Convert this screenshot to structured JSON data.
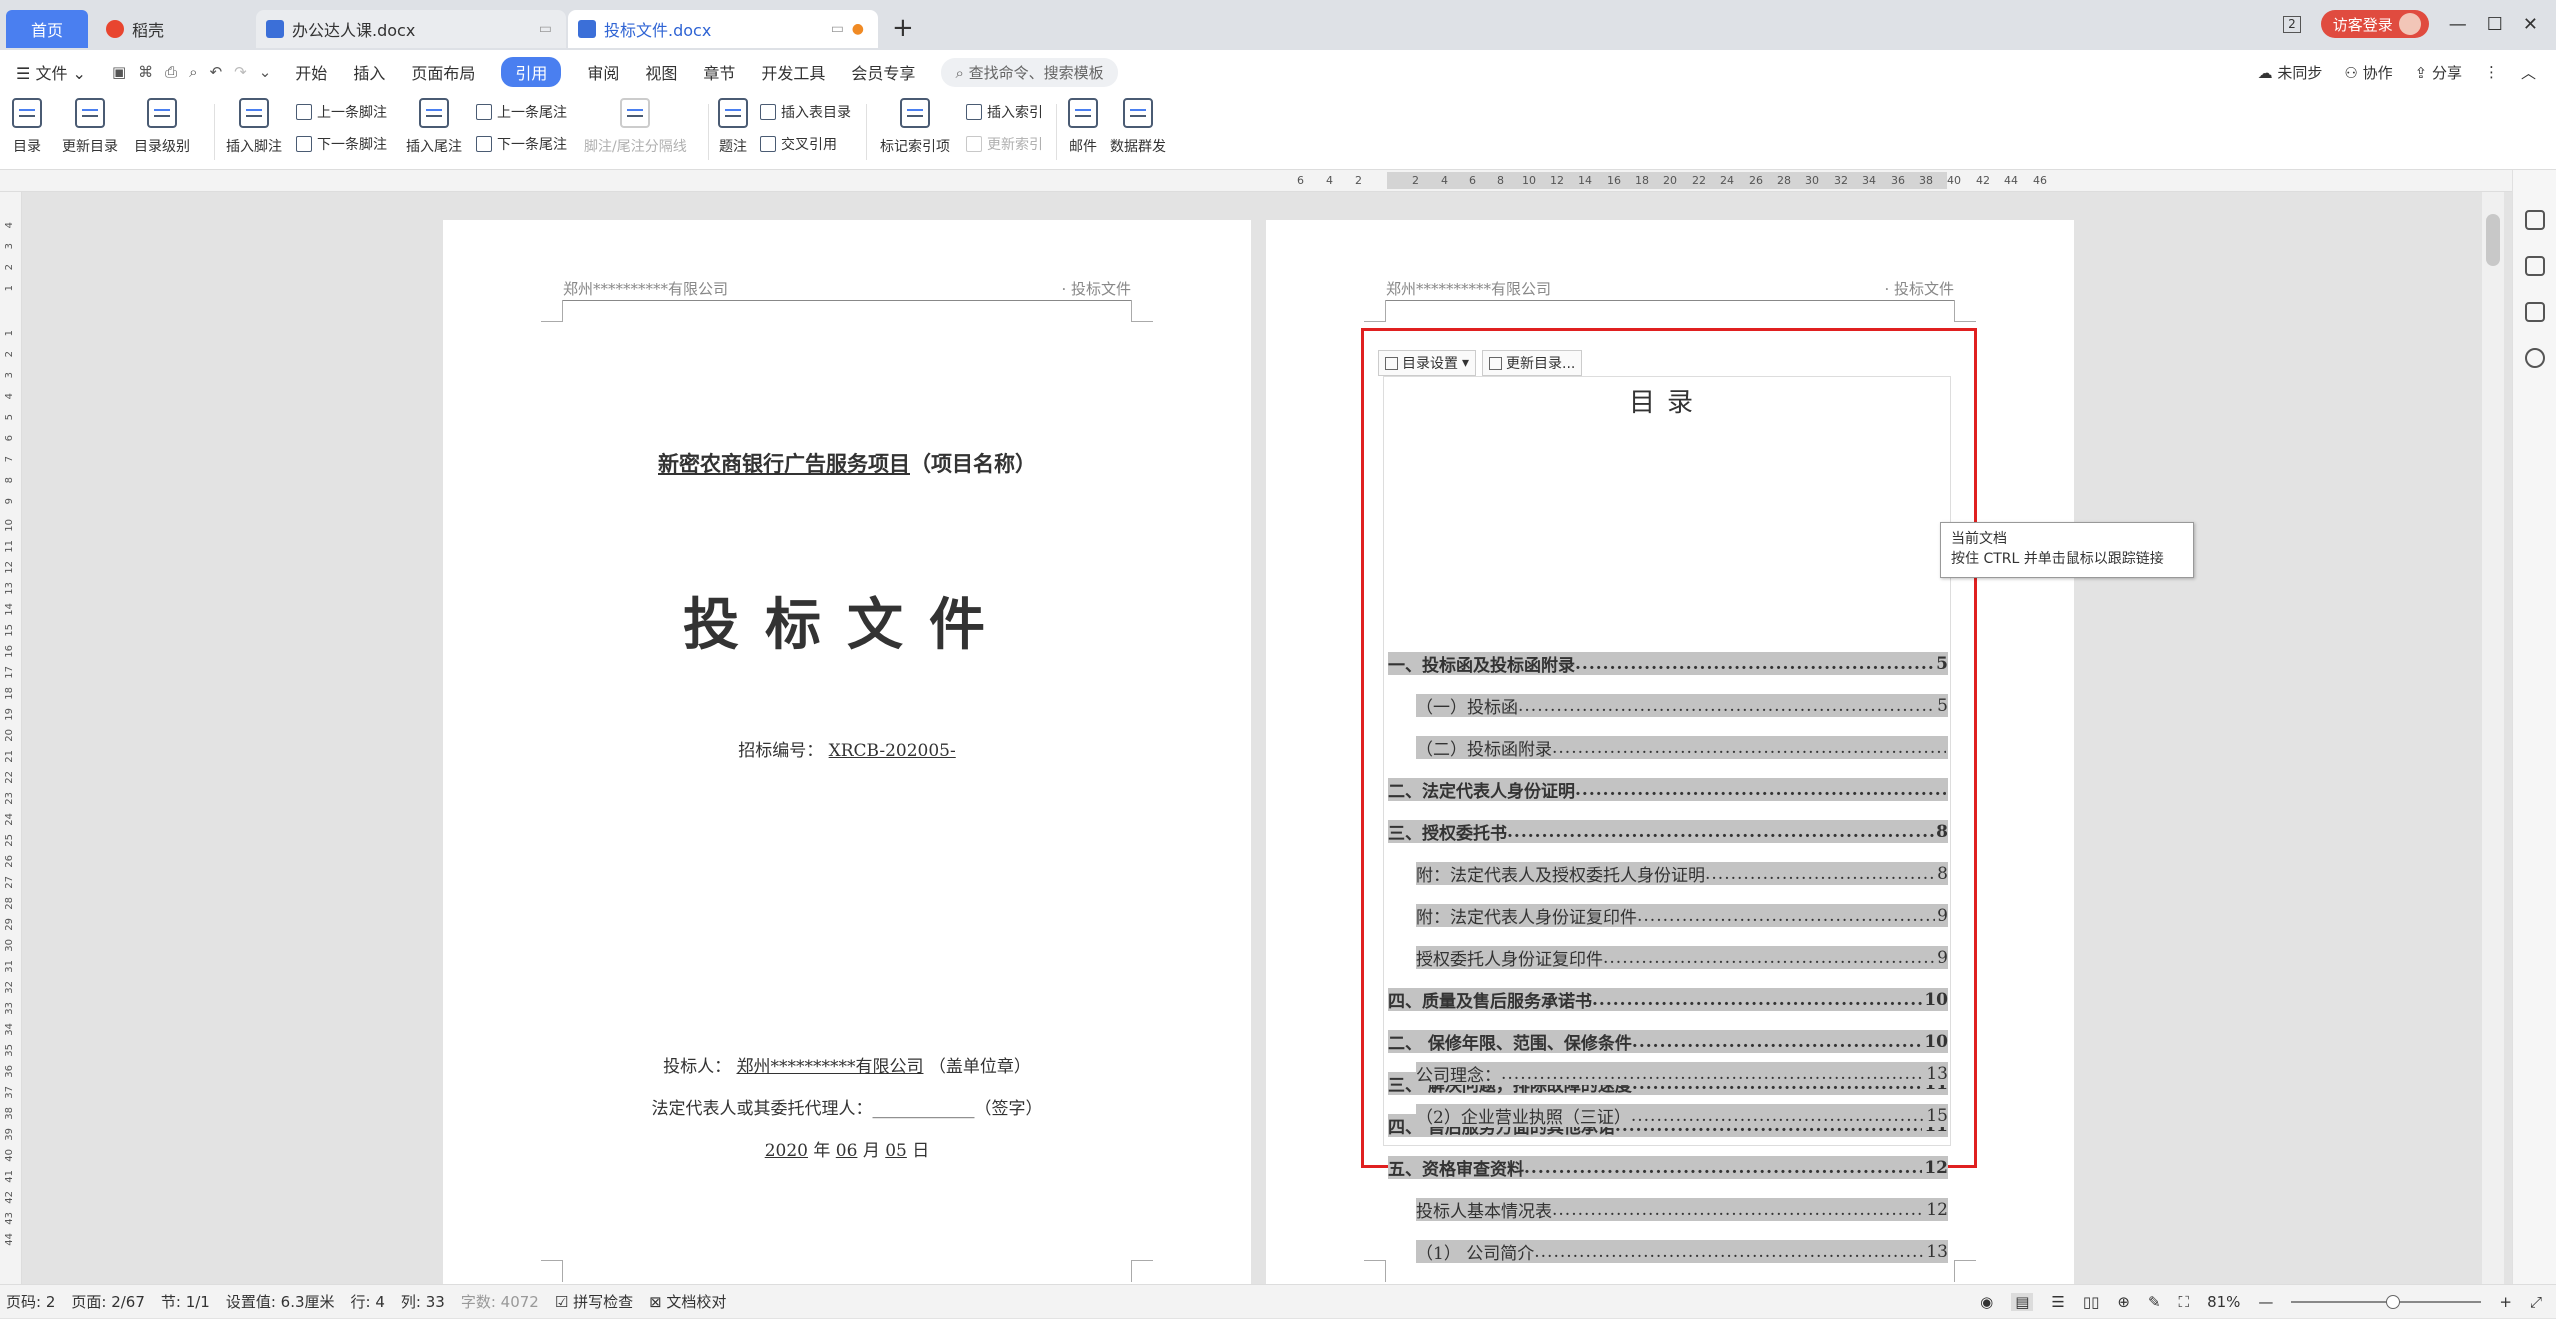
{
  "tabs": {
    "home": "首页",
    "shell": "稻壳",
    "doc1": "办公达人课.docx",
    "doc2": "投标文件.docx",
    "new": "+"
  },
  "window": {
    "badge": "2",
    "login": "访客登录"
  },
  "menu": {
    "file": "文件",
    "items": [
      "开始",
      "插入",
      "页面布局",
      "引用",
      "审阅",
      "视图",
      "章节",
      "开发工具",
      "会员专享"
    ],
    "search": "查找命令、搜索模板",
    "right": [
      "未同步",
      "协作",
      "分享"
    ]
  },
  "ribbon": {
    "toc": "目录",
    "update_toc": "更新目录",
    "toc_level": "目录级别",
    "insert_footnote": "插入脚注",
    "prev_footnote": "上一条脚注",
    "next_footnote": "下一条脚注",
    "insert_endnote": "插入尾注",
    "prev_endnote": "上一条尾注",
    "next_endnote": "下一条尾注",
    "separator": "脚注/尾注分隔线",
    "caption": "题注",
    "insert_table_toc": "插入表目录",
    "cross_ref": "交叉引用",
    "mark_index": "标记索引项",
    "insert_index": "插入索引",
    "update_index": "更新索引",
    "mail": "邮件",
    "mail_merge": "数据群发"
  },
  "ruler": {
    "h_labels": [
      "6",
      "4",
      "2",
      "2",
      "4",
      "6",
      "8",
      "10",
      "12",
      "14",
      "16",
      "18",
      "20",
      "22",
      "24",
      "26",
      "28",
      "30",
      "32",
      "34",
      "36",
      "38",
      "40",
      "42",
      "44",
      "46"
    ],
    "v_labels": [
      "4",
      "3",
      "2",
      "1",
      "1",
      "2",
      "3",
      "4",
      "5",
      "6",
      "7",
      "8",
      "9",
      "10",
      "11",
      "12",
      "13",
      "14",
      "15",
      "16",
      "17",
      "18",
      "19",
      "20",
      "21",
      "22",
      "23",
      "24",
      "25",
      "26",
      "27",
      "28",
      "29",
      "30",
      "31",
      "32",
      "33",
      "34",
      "35",
      "36",
      "37",
      "38",
      "39",
      "40",
      "41",
      "42",
      "43",
      "44"
    ]
  },
  "page1": {
    "header_left": "郑州**********有限公司",
    "header_right": "· 投标文件",
    "project_name": "新密农商银行广告服务项目",
    "project_suffix": "（项目名称）",
    "title": "投标文件",
    "bid_no_label": "招标编号：",
    "bid_no": "XRCB-202005-",
    "bidder_label": "投标人：",
    "bidder": "郑州**********有限公司",
    "bidder_suffix": "（盖单位章）",
    "legal_label": "法定代表人或其委托代理人：",
    "legal_blank": "____________",
    "legal_suffix": "（签字）",
    "year": "2020",
    "year_unit": "年",
    "month": "06",
    "month_unit": "月",
    "day": "05",
    "day_unit": "日"
  },
  "page2": {
    "header_left": "郑州**********有限公司",
    "header_right": "· 投标文件",
    "toc_settings": "目录设置",
    "update_toc": "更新目录...",
    "toc_title": "目录",
    "toc": [
      {
        "text": "一、投标函及投标函附录",
        "page": "5",
        "level": 1
      },
      {
        "text": "（一）投标函",
        "page": "5",
        "level": 2
      },
      {
        "text": "（二）投标函附录",
        "page": "",
        "level": 2
      },
      {
        "text": "二、法定代表人身份证明",
        "page": "",
        "level": 1
      },
      {
        "text": "三、授权委托书",
        "page": "8",
        "level": 1
      },
      {
        "text": "附：法定代表人及授权委托人身份证明",
        "page": "8",
        "level": 2
      },
      {
        "text": "附：法定代表人身份证复印件",
        "page": "9",
        "level": 2
      },
      {
        "text": "授权委托人身份证复印件",
        "page": "9",
        "level": 2
      },
      {
        "text": "四、质量及售后服务承诺书",
        "page": "10",
        "level": 1
      },
      {
        "text": "二、 保修年限、范围、保修条件",
        "page": "10",
        "level": 1
      },
      {
        "text": "三、 解决问题，排除故障的速度",
        "page": "11",
        "level": 1
      },
      {
        "text": "四、 售后服务方面的其他承诺",
        "page": "11",
        "level": 1
      },
      {
        "text": "五、资格审查资料",
        "page": "12",
        "level": 1
      },
      {
        "text": "投标人基本情况表",
        "page": "12",
        "level": 2
      },
      {
        "text": "（1） 公司简介",
        "page": "13",
        "level": 2
      },
      {
        "text": "公司理念：",
        "page": "13",
        "level": 2
      },
      {
        "text": "（2）企业营业执照（三证）",
        "page": "15",
        "level": 2
      }
    ]
  },
  "tooltip": {
    "line1": "当前文档",
    "line2": "按住 CTRL 并单击鼠标以跟踪链接"
  },
  "status": {
    "page_code": "页码: 2",
    "pages": "页面: 2/67",
    "section": "节: 1/1",
    "setting": "设置值: 6.3厘米",
    "row": "行: 4",
    "col": "列: 33",
    "words": "字数: 4072",
    "spell": "拼写检查",
    "proof": "文档校对",
    "zoom": "81%"
  }
}
